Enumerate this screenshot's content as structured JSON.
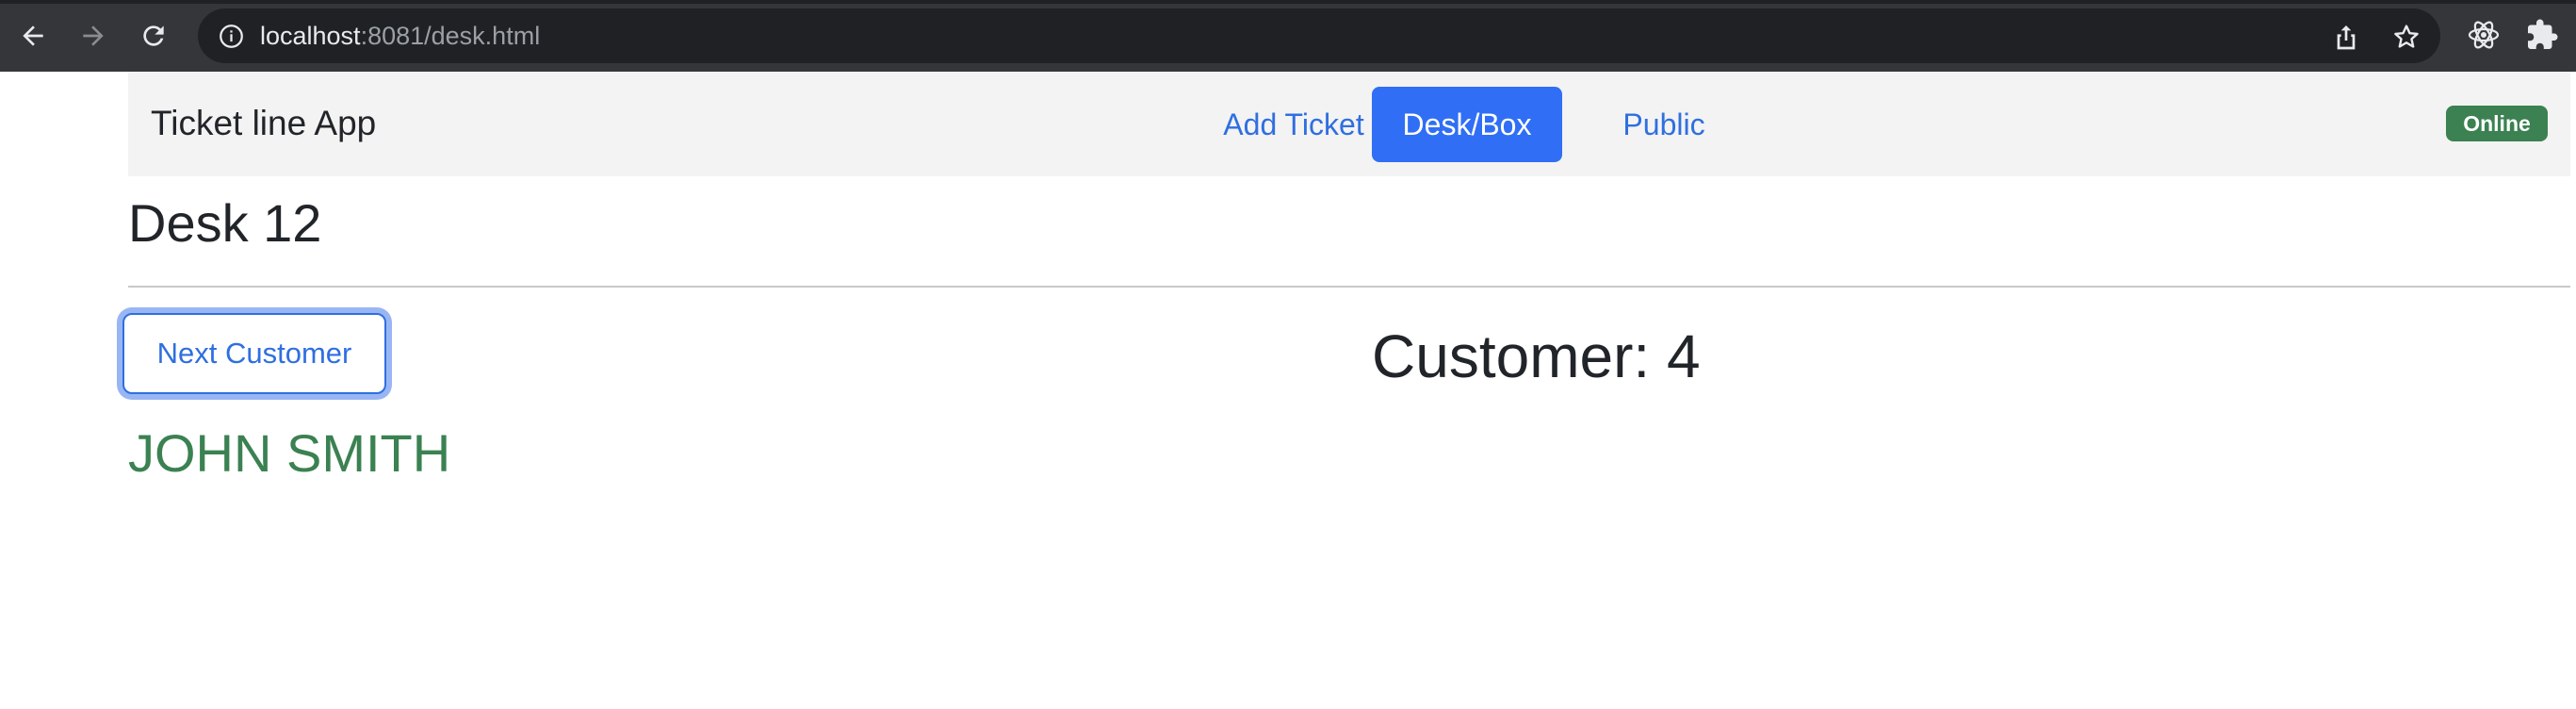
{
  "browser": {
    "url_host": "localhost",
    "url_path": ":8081/desk.html",
    "icons": [
      "back-icon",
      "forward-icon",
      "reload-icon",
      "site-info-icon",
      "share-icon",
      "bookmark-star-icon",
      "react-devtools-icon",
      "extensions-puzzle-icon"
    ]
  },
  "navbar": {
    "brand": "Ticket line App",
    "links": [
      {
        "label": "Add Ticket",
        "active": false
      },
      {
        "label": "Desk/Box",
        "active": true
      },
      {
        "label": "Public",
        "active": false
      }
    ],
    "status_badge": "Online"
  },
  "main": {
    "desk_title": "Desk 12",
    "next_button_label": "Next Customer",
    "customer_name": "JOHN SMITH",
    "customer_label": "Customer: 4"
  },
  "colors": {
    "primary": "#306ff5",
    "link": "#2f6fe0",
    "success": "#3b8152",
    "navbar_bg": "#f3f3f3",
    "chrome_bg": "#35363a"
  }
}
